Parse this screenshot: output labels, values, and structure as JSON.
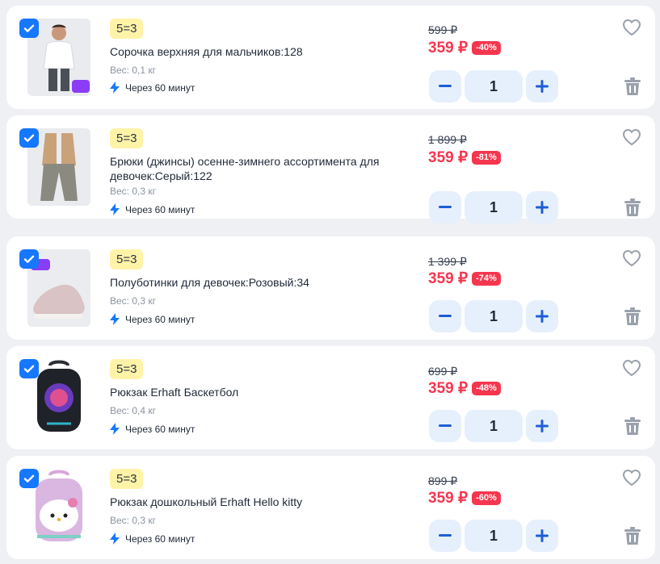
{
  "items": [
    {
      "promo": "5=3",
      "title": "Сорочка верхняя для мальчиков:128",
      "weight": "Вес: 0,1 кг",
      "delivery": "Через 60 минут",
      "old_price": "599 ₽",
      "price": "359 ₽",
      "discount": "-40%",
      "quantity": "1",
      "checked": true,
      "image_icon": "shirt-photo",
      "sticker": "супер цена"
    },
    {
      "promo": "5=3",
      "title": "Брюки (джинсы) осенне-зимнего ассортимента для девочек:Серый:122",
      "weight": "Вес: 0,3 кг",
      "delivery": "Через 60 минут",
      "old_price": "1 899 ₽",
      "price": "359 ₽",
      "discount": "-81%",
      "quantity": "1",
      "checked": true,
      "image_icon": "pants-photo"
    },
    {
      "promo": "5=3",
      "title": "Полуботинки для девочек:Розовый:34",
      "weight": "Вес: 0,3 кг",
      "delivery": "Через 60 минут",
      "old_price": "1 399 ₽",
      "price": "359 ₽",
      "discount": "-74%",
      "quantity": "1",
      "checked": true,
      "image_icon": "sneaker-photo",
      "sticker": "супер цена"
    },
    {
      "promo": "5=3",
      "title": "Рюкзак Erhaft Баскетбол",
      "weight": "Вес: 0,4 кг",
      "delivery": "Через 60 минут",
      "old_price": "699 ₽",
      "price": "359 ₽",
      "discount": "-48%",
      "quantity": "1",
      "checked": true,
      "image_icon": "backpack-photo"
    },
    {
      "promo": "5=3",
      "title": "Рюкзак дошкольный Erhaft Hello kitty",
      "weight": "Вес: 0,3 кг",
      "delivery": "Через 60 минут",
      "old_price": "899 ₽",
      "price": "359 ₽",
      "discount": "-60%",
      "quantity": "1",
      "checked": true,
      "image_icon": "kitty-backpack-photo"
    }
  ],
  "colors": {
    "accent": "#1677ff",
    "price_red": "#f5364f",
    "promo_bg": "#fff3a8",
    "stepper_bg": "#e6f0fc"
  }
}
